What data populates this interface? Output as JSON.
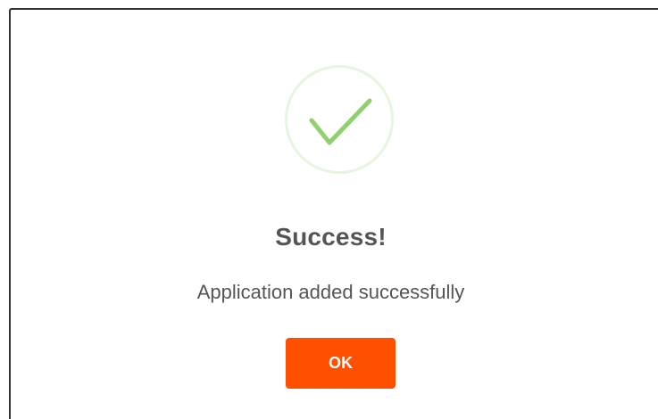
{
  "dialog": {
    "title": "Success!",
    "message": "Application added successfully",
    "ok_label": "OK",
    "icon": "checkmark-icon"
  },
  "colors": {
    "accent": "#fe5000",
    "success_check": "#8fd16f",
    "success_ring": "#e6f5dd",
    "text": "#555555",
    "border": "#333333"
  }
}
